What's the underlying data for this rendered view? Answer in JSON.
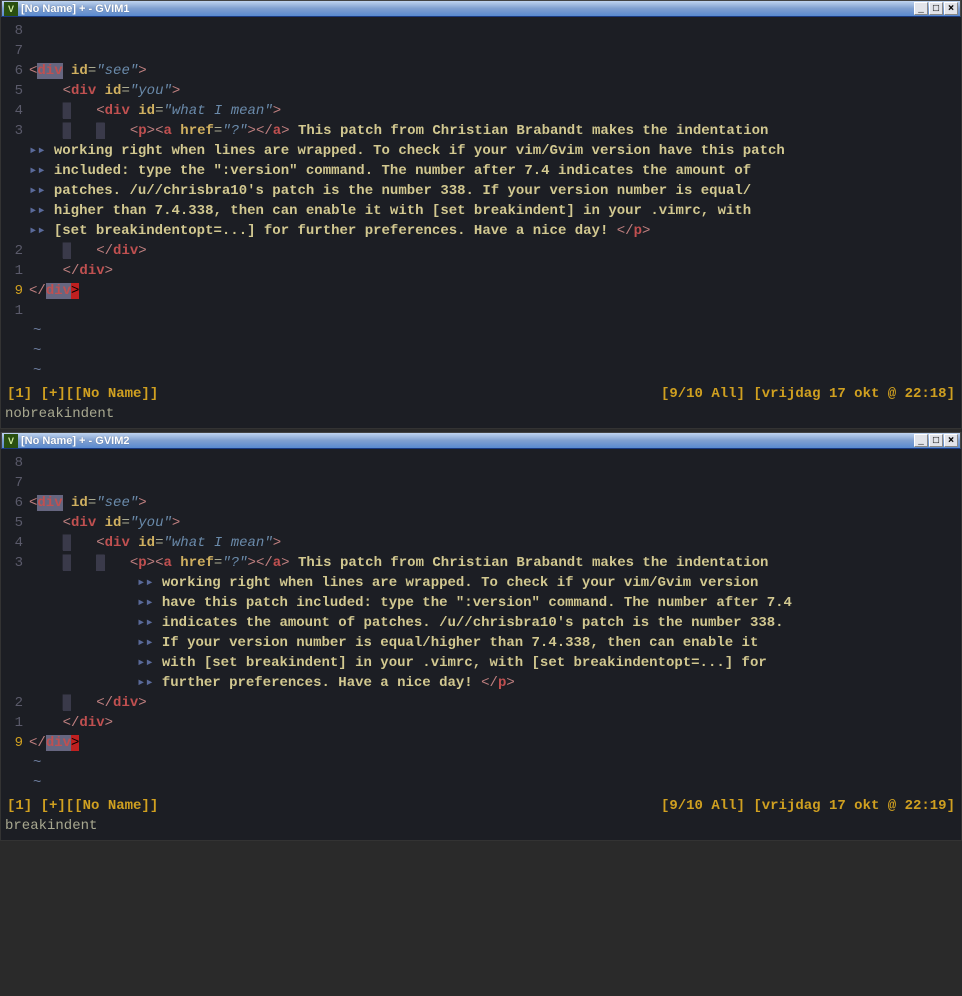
{
  "window1": {
    "title": "[No Name] + - GVIM1",
    "gutter": [
      "8",
      "7",
      "6",
      "5",
      "4",
      "3",
      "2",
      "1",
      "9",
      "1"
    ],
    "code": {
      "l6_id": "see",
      "l5_id": "you",
      "l4_id": "what I mean",
      "l3_href": "?",
      "para_full": "This patch from Christian Brabandt makes the indentation working right when lines are wrapped. To check if your vim/Gvim version have this patch included: type the \":version\" command. The number after 7.4 indicates the amount of patches. /u//chrisbra10's patch is the number 338. If your version number is equal/higher than 7.4.338, then can enable it with [set breakindent] in your .vimrc, with [set breakindentopt=...] for further preferences. Have a nice day!",
      "wrap1": "working right when lines are wrapped. To check if your vim/Gvim version have this patch",
      "wrap2": "included: type the \":version\" command. The number after 7.4 indicates the amount of",
      "wrap3": "patches. /u//chrisbra10's patch is the number 338. If your version number is equal/",
      "wrap4": "higher than 7.4.338, then can enable it with [set breakindent] in your .vimrc, with",
      "wrap5_a": "[set breakindentopt=...] for further preferences. Have a nice day! "
    },
    "status_left": "[1] [+][[No Name]]",
    "status_right": "[9/10 All] [vrijdag 17 okt @ 22:18]",
    "cmd": "nobreakindent"
  },
  "window2": {
    "title": "[No Name] + - GVIM2",
    "gutter": [
      "8",
      "7",
      "6",
      "5",
      "4",
      "3",
      "2",
      "1",
      "9"
    ],
    "code": {
      "l6_id": "see",
      "l5_id": "you",
      "l4_id": "what I mean",
      "l3_href": "?",
      "wrap1": "working right when lines are wrapped. To check if your vim/Gvim version",
      "wrap2": "have this patch included: type the \":version\" command. The number after 7.4",
      "wrap3": "indicates the amount of patches. /u//chrisbra10's patch is the number 338.",
      "wrap4": "If your version number is equal/higher than 7.4.338, then can enable it",
      "wrap5": "with [set breakindent] in your .vimrc, with [set breakindentopt=...] for",
      "wrap6_a": "further preferences. Have a nice day! "
    },
    "status_left": "[1] [+][[No Name]]",
    "status_right": "[9/10 All] [vrijdag 17 okt @ 22:19]",
    "cmd": "  breakindent"
  },
  "labels": {
    "first_line_txt": " This patch from Christian Brabandt makes the indentation",
    "wrap_marker": "▸▸"
  }
}
